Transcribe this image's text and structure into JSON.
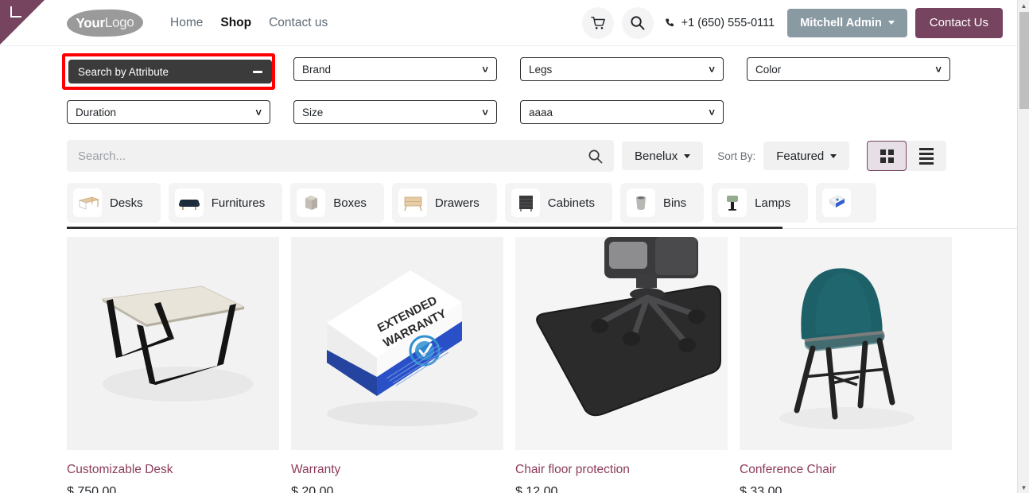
{
  "header": {
    "logo_bold": "Your",
    "logo_light": "Logo",
    "nav": [
      {
        "label": "Home",
        "active": false
      },
      {
        "label": "Shop",
        "active": true
      },
      {
        "label": "Contact us",
        "active": false
      }
    ],
    "cart_icon": "shopping-cart-icon",
    "search_icon": "search-icon",
    "phone_icon": "phone-icon",
    "phone": "+1 (650) 555-0111",
    "user_label": "Mitchell Admin",
    "contact_label": "Contact Us"
  },
  "filters": {
    "attribute_button": {
      "label": "Search by Attribute",
      "icon": "minus-icon",
      "expanded": true,
      "highlight_color": "#ff0000"
    },
    "selects": [
      {
        "label": "Brand"
      },
      {
        "label": "Legs"
      },
      {
        "label": "Color"
      },
      {
        "label": "Duration"
      },
      {
        "label": "Size"
      },
      {
        "label": "aaaa"
      }
    ]
  },
  "toolbar": {
    "search_placeholder": "Search...",
    "search_value": "",
    "search_icon": "search-icon",
    "pricelist_label": "Benelux",
    "sort_by_label": "Sort By:",
    "sort_value": "Featured",
    "grid_view_icon": "grid-view-icon",
    "list_view_icon": "list-view-icon",
    "active_view": "grid"
  },
  "categories": [
    {
      "label": "Desks",
      "icon": "desk-thumb-icon"
    },
    {
      "label": "Furnitures",
      "icon": "sofa-thumb-icon"
    },
    {
      "label": "Boxes",
      "icon": "box-thumb-icon"
    },
    {
      "label": "Drawers",
      "icon": "drawer-thumb-icon"
    },
    {
      "label": "Cabinets",
      "icon": "cabinet-thumb-icon"
    },
    {
      "label": "Bins",
      "icon": "bin-thumb-icon"
    },
    {
      "label": "Lamps",
      "icon": "lamp-thumb-icon"
    },
    {
      "label": "",
      "icon": "warranty-thumb-icon"
    }
  ],
  "products": [
    {
      "name": "Customizable Desk",
      "price": "$ 750.00",
      "image": "desk-image"
    },
    {
      "name": "Warranty",
      "price": "$ 20.00",
      "image": "warranty-box-image",
      "box_line1": "EXTENDED",
      "box_line2": "WARRANTY"
    },
    {
      "name": "Chair floor protection",
      "price": "$ 12.00",
      "image": "floor-mat-image"
    },
    {
      "name": "Conference Chair",
      "price": "$ 33.00",
      "image": "conference-chair-image"
    }
  ],
  "scrollbar": {
    "up_arrow": "scroll-up-icon",
    "down_arrow": "scroll-down-icon"
  },
  "colors": {
    "brand_purple": "#76445f",
    "product_link": "#8c3b5a",
    "user_button": "#8a9aa3",
    "attribute_dark": "#3b3b3b",
    "highlight_red": "#ff0000"
  }
}
